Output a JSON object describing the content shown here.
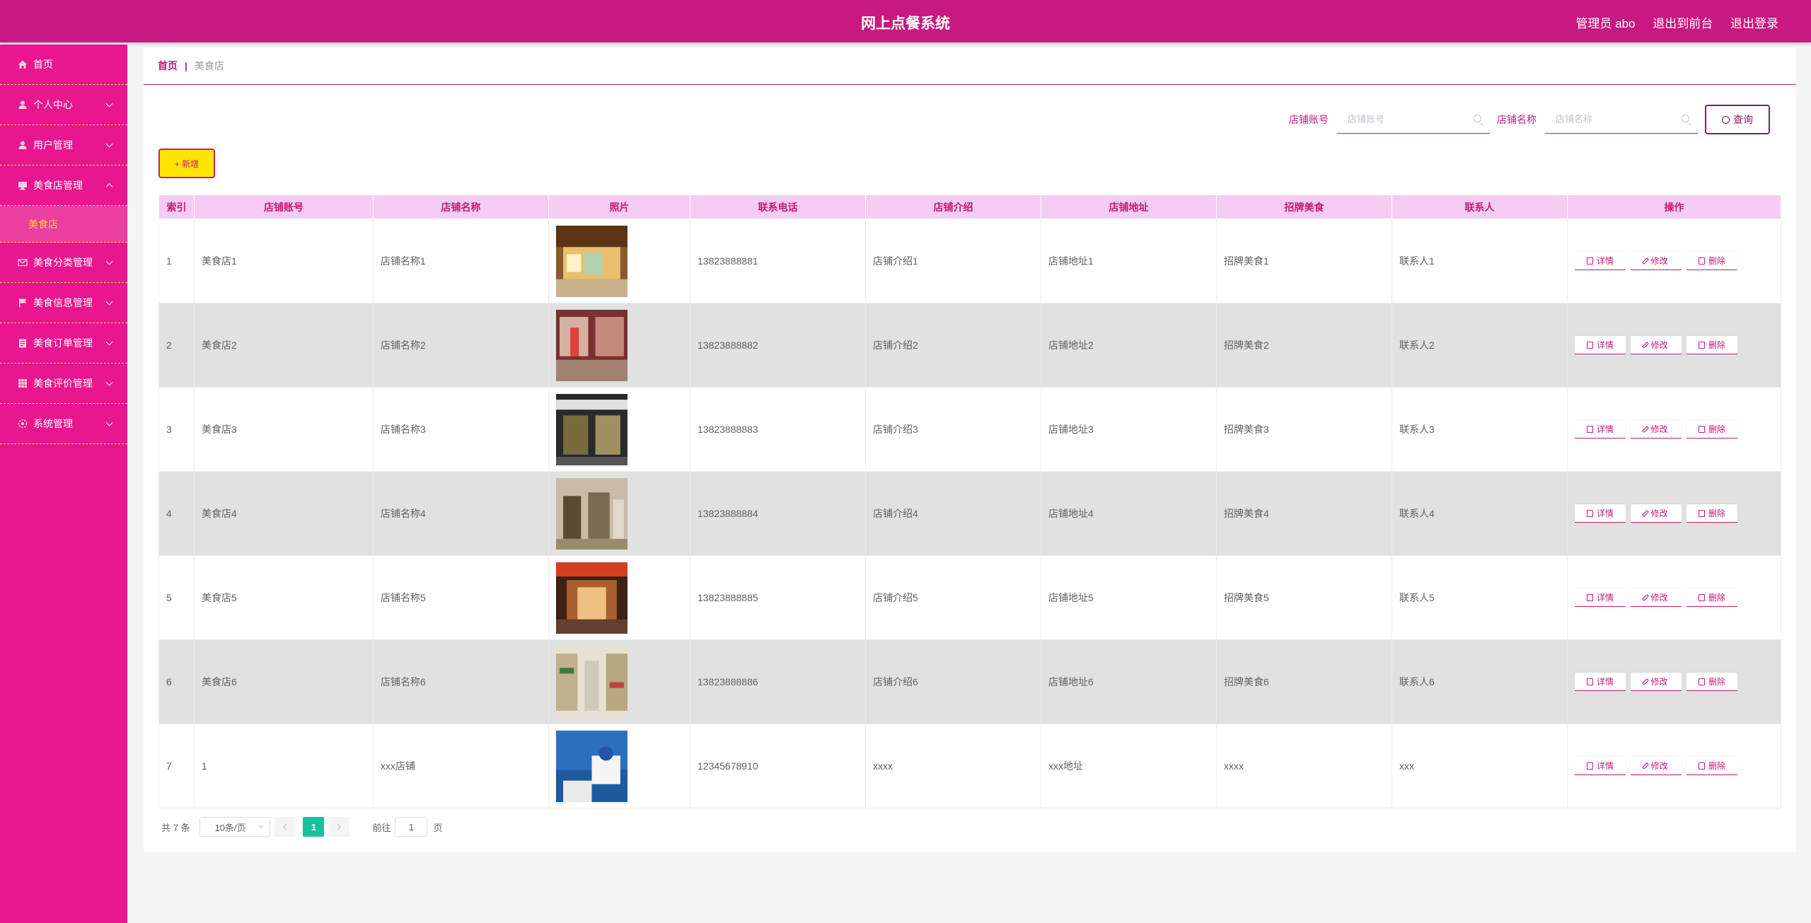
{
  "header": {
    "title": "网上点餐系统",
    "admin_label": "管理员 abo",
    "back_label": "退出到前台",
    "logout_label": "退出登录"
  },
  "sidebar": {
    "items": [
      {
        "label": "首页",
        "icon": "home-icon",
        "expandable": false
      },
      {
        "label": "个人中心",
        "icon": "user-icon",
        "expandable": true
      },
      {
        "label": "用户管理",
        "icon": "user-icon",
        "expandable": true
      },
      {
        "label": "美食店管理",
        "icon": "shop-icon",
        "expandable": true,
        "expanded": true
      },
      {
        "label": "美食分类管理",
        "icon": "mail-icon",
        "expandable": true
      },
      {
        "label": "美食信息管理",
        "icon": "flag-icon",
        "expandable": true
      },
      {
        "label": "美食订单管理",
        "icon": "order-icon",
        "expandable": true
      },
      {
        "label": "美食评价管理",
        "icon": "grid-icon",
        "expandable": true
      },
      {
        "label": "系统管理",
        "icon": "settings-icon",
        "expandable": true
      }
    ],
    "subitem": "美食店"
  },
  "breadcrumb": {
    "home": "首页",
    "separator": "|",
    "current": "美食店"
  },
  "search": {
    "account_label": "店铺账号",
    "account_placeholder": "店铺账号",
    "name_label": "店铺名称",
    "name_placeholder": "店铺名称",
    "query_label": "查询"
  },
  "toolbar": {
    "add_label": "+ 新增"
  },
  "table": {
    "columns": [
      "索引",
      "店铺账号",
      "店铺名称",
      "照片",
      "联系电话",
      "店铺介绍",
      "店铺地址",
      "招牌美食",
      "联系人",
      "操作"
    ],
    "rows": [
      {
        "index": "1",
        "account": "美食店1",
        "name": "店铺名称1",
        "phone": "13823888881",
        "intro": "店铺介绍1",
        "address": "店铺地址1",
        "signature": "招牌美食1",
        "contact": "联系人1"
      },
      {
        "index": "2",
        "account": "美食店2",
        "name": "店铺名称2",
        "phone": "13823888882",
        "intro": "店铺介绍2",
        "address": "店铺地址2",
        "signature": "招牌美食2",
        "contact": "联系人2"
      },
      {
        "index": "3",
        "account": "美食店3",
        "name": "店铺名称3",
        "phone": "13823888883",
        "intro": "店铺介绍3",
        "address": "店铺地址3",
        "signature": "招牌美食3",
        "contact": "联系人3"
      },
      {
        "index": "4",
        "account": "美食店4",
        "name": "店铺名称4",
        "phone": "13823888884",
        "intro": "店铺介绍4",
        "address": "店铺地址4",
        "signature": "招牌美食4",
        "contact": "联系人4"
      },
      {
        "index": "5",
        "account": "美食店5",
        "name": "店铺名称5",
        "phone": "13823888885",
        "intro": "店铺介绍5",
        "address": "店铺地址5",
        "signature": "招牌美食5",
        "contact": "联系人5"
      },
      {
        "index": "6",
        "account": "美食店6",
        "name": "店铺名称6",
        "phone": "13823888886",
        "intro": "店铺介绍6",
        "address": "店铺地址6",
        "signature": "招牌美食6",
        "contact": "联系人6"
      },
      {
        "index": "7",
        "account": "1",
        "name": "xxx店铺",
        "phone": "12345678910",
        "intro": "xxxx",
        "address": "xxx地址",
        "signature": "xxxx",
        "contact": "xxx"
      }
    ],
    "actions": {
      "detail": "详情",
      "edit": "修改",
      "delete": "删除"
    }
  },
  "pagination": {
    "total": "共 7 条",
    "page_size": "10条/页",
    "current_page": "1",
    "goto_prefix": "前往",
    "goto_value": "1",
    "goto_suffix": "页"
  },
  "colors": {
    "brand": "#c7197f",
    "sidebar": "#e8168f",
    "header_bg": "#f5ccf2",
    "add_button": "#ffe500",
    "page_active": "#18c0a0"
  }
}
